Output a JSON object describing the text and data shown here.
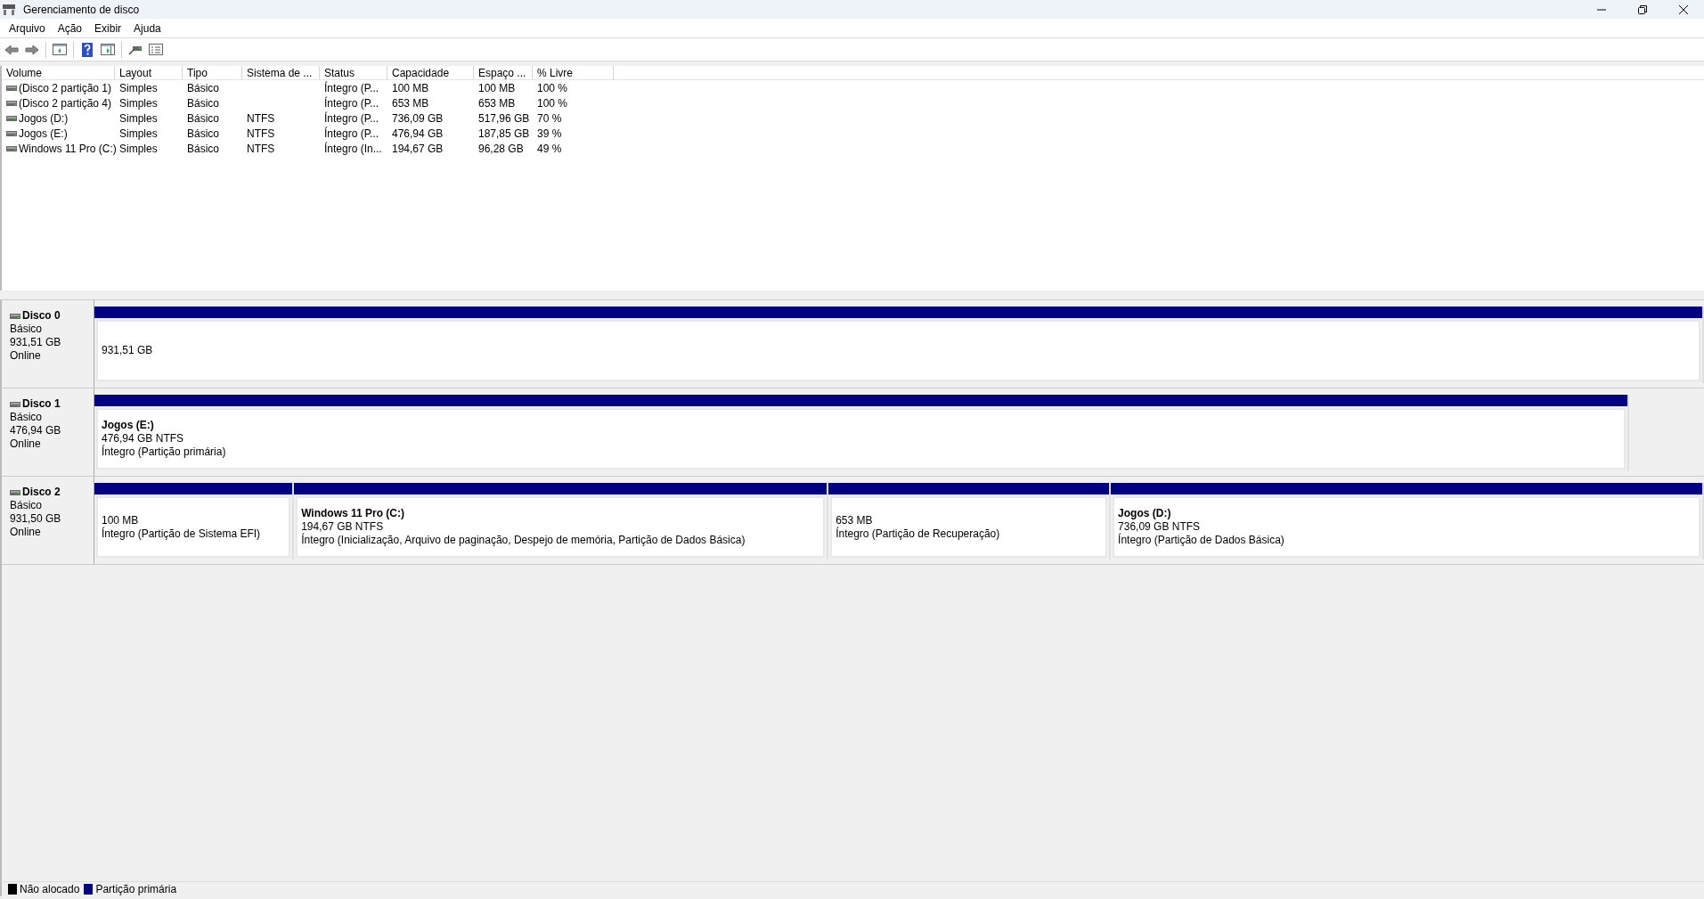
{
  "window": {
    "title": "Gerenciamento de disco"
  },
  "menu": [
    "Arquivo",
    "Ação",
    "Exibir",
    "Ajuda"
  ],
  "table": {
    "columns": [
      "Volume",
      "Layout",
      "Tipo",
      "Sistema de ...",
      "Status",
      "Capacidade",
      "Espaço ...",
      "% Livre"
    ],
    "rows": [
      [
        "(Disco 2 partição 1)",
        "Simples",
        "Básico",
        "",
        "Íntegro (P...",
        "100 MB",
        "100 MB",
        "100 %"
      ],
      [
        "(Disco 2 partição 4)",
        "Simples",
        "Básico",
        "",
        "Íntegro (P...",
        "653 MB",
        "653 MB",
        "100 %"
      ],
      [
        "Jogos (D:)",
        "Simples",
        "Básico",
        "NTFS",
        "Íntegro (P...",
        "736,09 GB",
        "517,96 GB",
        "70 %"
      ],
      [
        "Jogos (E:)",
        "Simples",
        "Básico",
        "NTFS",
        "Íntegro (P...",
        "476,94 GB",
        "187,85 GB",
        "39 %"
      ],
      [
        "Windows 11 Pro (C:)",
        "Simples",
        "Básico",
        "NTFS",
        "Íntegro (In...",
        "194,67 GB",
        "96,28 GB",
        "49 %"
      ]
    ]
  },
  "disks": [
    {
      "name": "Disco 0",
      "type": "Básico",
      "size": "931,51 GB",
      "status": "Online",
      "partitions": [
        {
          "size": "931,51 GB"
        }
      ]
    },
    {
      "name": "Disco 1",
      "type": "Básico",
      "size": "476,94 GB",
      "status": "Online",
      "partitions": [
        {
          "title": "Jogos  (E:)",
          "size": "476,94 GB NTFS",
          "status": "Íntegro (Partição primária)"
        }
      ]
    },
    {
      "name": "Disco 2",
      "type": "Básico",
      "size": "931,50 GB",
      "status": "Online",
      "partitions": [
        {
          "size": "100 MB",
          "status": "Íntegro (Partição de Sistema EFI)"
        },
        {
          "title": "Windows 11 Pro  (C:)",
          "size": "194,67 GB NTFS",
          "status": "Íntegro (Inicialização, Arquivo de paginação, Despejo de memória, Partição de Dados Básica)"
        },
        {
          "size": "653 MB",
          "status": "Íntegro (Partição de Recuperação)"
        },
        {
          "title": "Jogos  (D:)",
          "size": "736,09 GB NTFS",
          "status": "Íntegro (Partição de Dados Básica)"
        }
      ]
    }
  ],
  "legend": [
    {
      "label": "Não alocado",
      "color": "#000000"
    },
    {
      "label": "Partição primária",
      "color": "#000080"
    }
  ]
}
